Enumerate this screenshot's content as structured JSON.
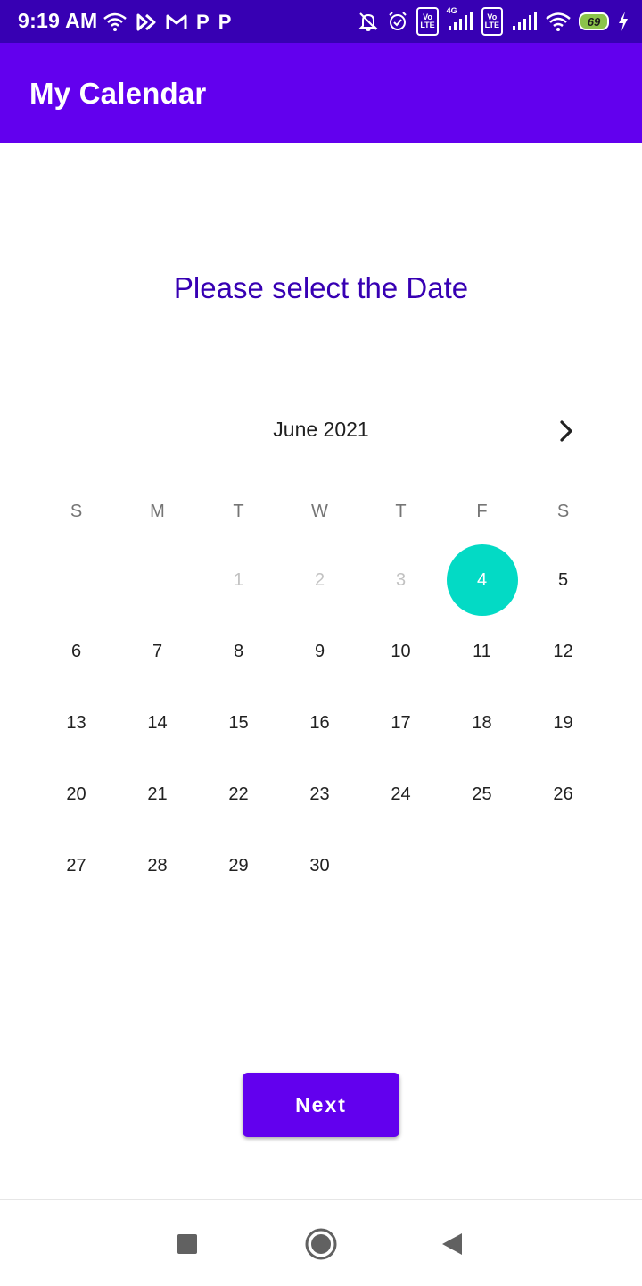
{
  "status_bar": {
    "time": "9:19 AM",
    "left_icons": [
      "wifi-icon",
      "app-icon",
      "gmail-icon",
      "p-icon",
      "p-icon"
    ],
    "p_letter": "P",
    "volte_label": "Vo\nLTE",
    "network_label": "4G",
    "battery_level": "69",
    "right_icons": [
      "mute-icon",
      "alarm-icon",
      "volte-icon",
      "signal-icon",
      "volte-icon",
      "signal-icon",
      "wifi-icon",
      "battery-icon",
      "charging-icon"
    ]
  },
  "app_bar": {
    "title": "My Calendar",
    "color": "#6200ee"
  },
  "main": {
    "prompt": "Please select the Date",
    "calendar": {
      "month_label": "June 2021",
      "weekdays": [
        "S",
        "M",
        "T",
        "W",
        "T",
        "F",
        "S"
      ],
      "leading_blanks": 2,
      "days": [
        "1",
        "2",
        "3",
        "4",
        "5",
        "6",
        "7",
        "8",
        "9",
        "10",
        "11",
        "12",
        "13",
        "14",
        "15",
        "16",
        "17",
        "18",
        "19",
        "20",
        "21",
        "22",
        "23",
        "24",
        "25",
        "26",
        "27",
        "28",
        "29",
        "30"
      ],
      "disabled_days": [
        "1",
        "2",
        "3"
      ],
      "selected_day": "4",
      "selected_color": "#03dac5"
    },
    "next_button": "Next"
  },
  "nav_bar": {
    "icons": [
      "recents-icon",
      "home-icon",
      "back-icon"
    ]
  }
}
